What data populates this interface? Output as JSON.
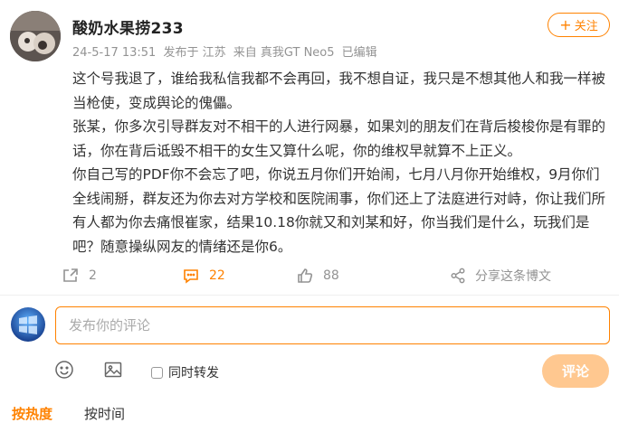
{
  "post": {
    "username": "酸奶水果捞233",
    "time": "24-5-17 13:51",
    "published_from": "发布于 江苏",
    "device": "来自 真我GT Neo5",
    "edited": "已编辑",
    "follow_label": "关注",
    "paragraphs": [
      "这个号我退了，谁给我私信我都不会再回，我不想自证，我只是不想其他人和我一样被当枪使，变成舆论的傀儡。",
      "张某，你多次引导群友对不相干的人进行网暴，如果刘的朋友们在背后梭梭你是有罪的话，你在背后诋毁不相干的女生又算什么呢，你的维权早就算不上正义。",
      "你自己写的PDF你不会忘了吧，你说五月你们开始闹，七月八月你开始维权，9月你们全线闹掰，群友还为你去对方学校和医院闹事，你们还上了法庭进行对峙，你让我们所有人都为你去痛恨崔家，结果10.18你就又和刘某和好，你当我们是什么，玩我们是吧？随意操纵网友的情绪还是你6。"
    ]
  },
  "actions": {
    "repost_count": "2",
    "comment_count": "22",
    "like_count": "88",
    "share_label": "分享这条博文"
  },
  "comment_box": {
    "placeholder": "发布你的评论",
    "repost_checkbox_label": "同时转发",
    "submit_label": "评论"
  },
  "sort": {
    "hot_label": "按热度",
    "time_label": "按时间"
  },
  "colors": {
    "accent": "#ff8200",
    "submit_disabled": "#ffc890",
    "meta_gray": "#939393"
  },
  "icons": {
    "repost": "repost-icon",
    "comment": "comment-icon",
    "like": "like-icon",
    "share": "share-icon",
    "emoji": "emoji-icon",
    "image": "image-icon"
  }
}
